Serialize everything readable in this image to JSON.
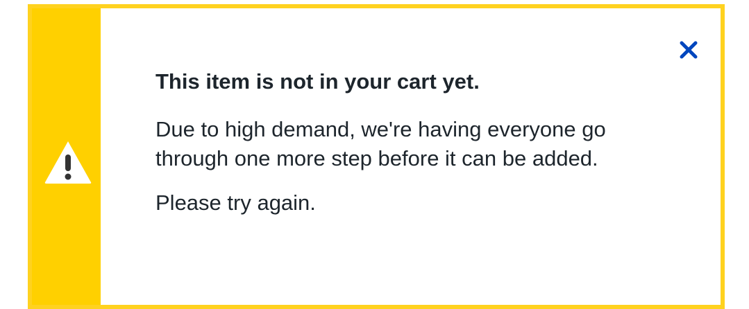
{
  "alert": {
    "title": "This item is not in your cart yet.",
    "message": "Due to high demand, we're having everyone go through one more step before it can be added.",
    "retry_message": "Please try again.",
    "icon": "warning-icon",
    "close_icon": "close-icon",
    "colors": {
      "accent": "#ffd000",
      "border": "#ffd21f",
      "close": "#0046be",
      "text": "#1d252c"
    }
  }
}
